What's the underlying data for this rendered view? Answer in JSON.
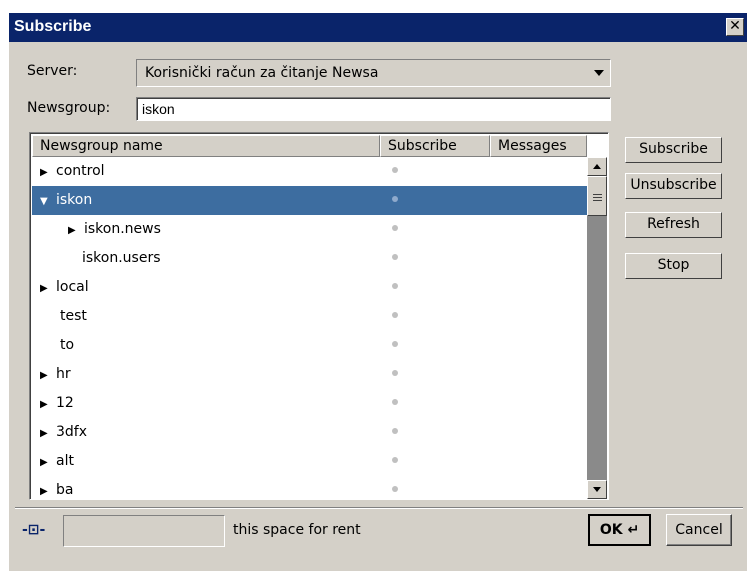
{
  "window": {
    "title": "Subscribe",
    "close_glyph": "✕"
  },
  "server": {
    "label": "Server:",
    "value": "Korisnički račun za čitanje Newsa"
  },
  "newsgroup": {
    "label": "Newsgroup:",
    "value": "iskon"
  },
  "columns": [
    "Newsgroup name",
    "Subscribe",
    "Messages"
  ],
  "rows": [
    {
      "name": "control",
      "expander": "▶",
      "selected": false
    },
    {
      "name": "iskon",
      "expander": "▼",
      "selected": true
    },
    {
      "name": "iskon.news",
      "expander": "▶",
      "selected": false
    },
    {
      "name": "iskon.users",
      "expander": "",
      "selected": false
    },
    {
      "name": "local",
      "expander": "▶",
      "selected": false
    },
    {
      "name": "test",
      "expander": "",
      "selected": false
    },
    {
      "name": "to",
      "expander": "",
      "selected": false
    },
    {
      "name": "hr",
      "expander": "▶",
      "selected": false
    },
    {
      "name": "12",
      "expander": "▶",
      "selected": false
    },
    {
      "name": "3dfx",
      "expander": "▶",
      "selected": false
    },
    {
      "name": "alt",
      "expander": "▶",
      "selected": false
    },
    {
      "name": "ba",
      "expander": "▶",
      "selected": false
    }
  ],
  "buttons": {
    "subscribe": "Subscribe",
    "unsubscribe": "Unsubscribe",
    "refresh": "Refresh",
    "stop": "Stop"
  },
  "status": {
    "text": "this space for rent",
    "icon": "connection-icon"
  },
  "footer": {
    "ok": "OK",
    "ok_glyph": "↵",
    "cancel": "Cancel"
  },
  "colors": {
    "titlebar": "#0a246a",
    "selection": "#3d6da0",
    "dialog": "#d4d0c8"
  }
}
